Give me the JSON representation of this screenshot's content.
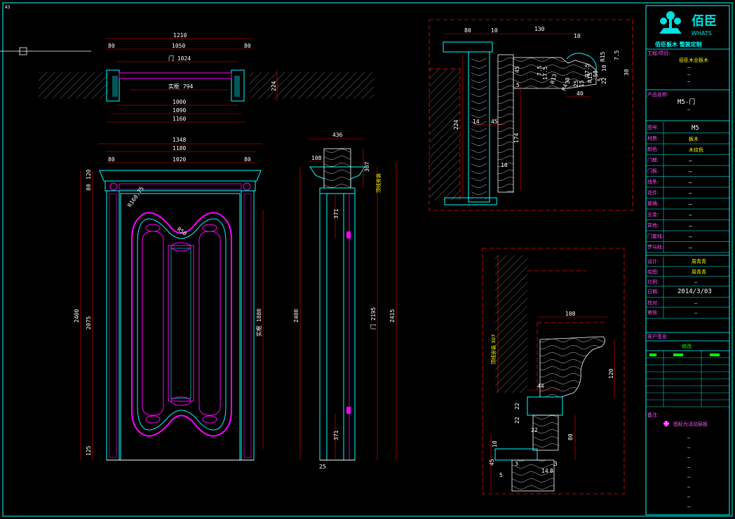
{
  "corner_label": "A3",
  "title_block": {
    "brand_cn": "佰臣",
    "brand_en": "WHATS",
    "slogan": "佰臣板木 整装定制",
    "project_label": "工程/项目:",
    "project_value": "佰臣木业板木",
    "product_label": "产品名称:",
    "product_value": "M5-门",
    "fields": [
      {
        "label": "图号:",
        "value": "M5"
      },
      {
        "label": "材质:",
        "value": "板木"
      },
      {
        "label": "颜色:",
        "value": "木纹色"
      },
      {
        "label": "门框:",
        "value": "—"
      },
      {
        "label": "门板:",
        "value": "—"
      },
      {
        "label": "线条:",
        "value": "—"
      },
      {
        "label": "花件:",
        "value": "—"
      },
      {
        "label": "玻璃:",
        "value": "—"
      },
      {
        "label": "五金:",
        "value": "—"
      },
      {
        "label": "其他:",
        "value": "—"
      },
      {
        "label": "门套线:",
        "value": "—"
      },
      {
        "label": "罗马柱:",
        "value": "—"
      }
    ],
    "design_label": "设计:",
    "design_value": "周青青",
    "draw_label": "绘图:",
    "draw_value": "周青青",
    "scale_label": "比例:",
    "scale_value": "—",
    "date_label": "日期:",
    "date_value": "2014/3/03",
    "check_label": "校对:",
    "check_value": "—",
    "approve_label": "审核:",
    "approve_value": "—",
    "client_sign_label": "客户签名:",
    "revision_header": "修改",
    "notes_label": "备注:",
    "notes_text": "图标为活动层板"
  },
  "plan_view": {
    "dims": [
      "1210",
      "80",
      "1050",
      "80",
      "门 1024",
      "实框 794",
      "1000",
      "1090",
      "1160",
      "224"
    ]
  },
  "elevation_front": {
    "dims": [
      "1348",
      "1180",
      "80",
      "1020",
      "80",
      "2400",
      "2075",
      "80",
      "120",
      "125",
      "R160.75",
      "R50",
      "实框 1880"
    ]
  },
  "elevation_side": {
    "dims": [
      "436",
      "108",
      "307",
      "371",
      "2400",
      "门 2195",
      "2415",
      "371",
      "25",
      "顶线安装"
    ]
  },
  "detail_top": {
    "dims": [
      "80",
      "10",
      "130",
      "10",
      "224",
      "14",
      "45",
      "174",
      "10",
      "45",
      "5",
      "7.5",
      "17.5",
      "R13",
      "40",
      "R4",
      "30",
      "25",
      "15",
      "R15",
      "22",
      "R7.5",
      "50",
      "5",
      "10",
      "R15",
      "30",
      "7.5"
    ]
  },
  "detail_bottom": {
    "dims": [
      "108",
      "顶线安装 307",
      "120",
      "44",
      "22",
      "22",
      "22",
      "10",
      "45",
      "80",
      "5",
      "3",
      "3",
      "14",
      "8"
    ]
  }
}
